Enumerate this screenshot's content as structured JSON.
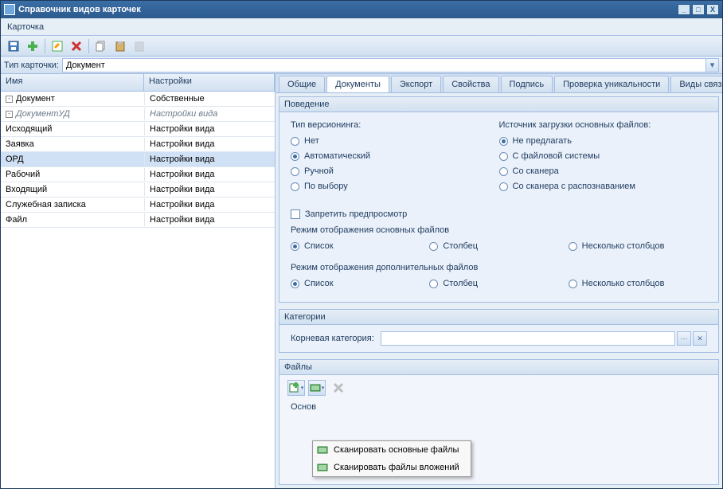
{
  "window": {
    "title": "Справочник видов карточек"
  },
  "menu": {
    "card": "Карточка"
  },
  "filter": {
    "label": "Тип карточки:",
    "value": "Документ"
  },
  "tree": {
    "columns": {
      "name": "Имя",
      "settings": "Настройки"
    },
    "rows": [
      {
        "name": "Документ",
        "settings": "Собственные",
        "indent": 1,
        "expander": "▾"
      },
      {
        "name": "ДокументУД",
        "settings": "Настройки вида",
        "indent": 2,
        "expander": "▾",
        "italic": true
      },
      {
        "name": "Исходящий",
        "settings": "Настройки вида",
        "indent": 3
      },
      {
        "name": "Заявка",
        "settings": "Настройки вида",
        "indent": 3
      },
      {
        "name": "ОРД",
        "settings": "Настройки вида",
        "indent": 3,
        "selected": true
      },
      {
        "name": "Рабочий",
        "settings": "Настройки вида",
        "indent": 3
      },
      {
        "name": "Входящий",
        "settings": "Настройки вида",
        "indent": 3
      },
      {
        "name": "Служебная записка",
        "settings": "Настройки вида",
        "indent": 3
      },
      {
        "name": "Файл",
        "settings": "Настройки вида",
        "indent": 2
      }
    ]
  },
  "tabs": [
    "Общие",
    "Документы",
    "Экспорт",
    "Свойства",
    "Подпись",
    "Проверка уникальности",
    "Виды связанных з"
  ],
  "active_tab": 1,
  "behavior": {
    "header": "Поведение",
    "versioning": {
      "label": "Тип версионинга:",
      "options": [
        "Нет",
        "Автоматический",
        "Ручной",
        "По выбору"
      ],
      "selected": 1
    },
    "upload_source": {
      "label": "Источник загрузки основных файлов:",
      "options": [
        "Не предлагать",
        "С файловой системы",
        "Со сканера",
        "Со сканера с распознаванием"
      ],
      "selected": 0
    },
    "forbid_preview": "Запретить предпросмотр",
    "main_mode": {
      "label": "Режим отображения основных файлов",
      "options": [
        "Список",
        "Столбец",
        "Несколько столбцов"
      ],
      "selected": 0
    },
    "extra_mode": {
      "label": "Режим отображения дополнительных файлов",
      "options": [
        "Список",
        "Столбец",
        "Несколько столбцов"
      ],
      "selected": 0
    }
  },
  "categories": {
    "header": "Категории",
    "root_label": "Корневая категория:"
  },
  "files": {
    "header": "Файлы",
    "main_label": "Основ",
    "menu": {
      "scan_main": "Сканировать основные файлы",
      "scan_attach": "Сканировать файлы вложений"
    }
  }
}
